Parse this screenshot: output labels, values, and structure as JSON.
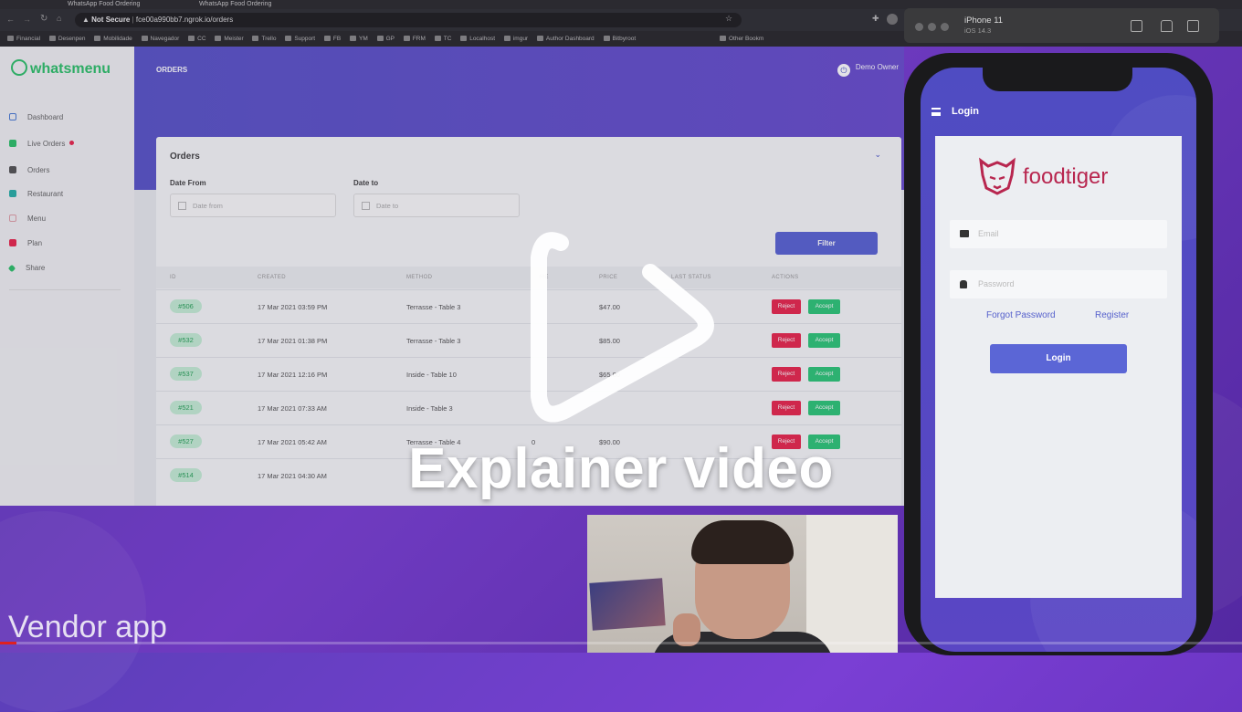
{
  "browser": {
    "tabs": [
      "WhatsApp Food Ordering",
      "WhatsApp Food Ordering"
    ],
    "security": "Not Secure",
    "url": "fce00a990bb7.ngrok.io/orders",
    "bookmarks": [
      "Financial",
      "Desenpen",
      "Mobilidade",
      "Navegador",
      "CC",
      "Meister",
      "Trello",
      "Support",
      "FB",
      "YM",
      "GP",
      "FRM",
      "TC",
      "Localhost",
      "imgur",
      "Author Dashboard",
      "Bitbyroot",
      "Other Bookm"
    ]
  },
  "app": {
    "logo": "whatsmenu",
    "header_title": "ORDERS",
    "user_name": "Demo Owner",
    "sidebar": {
      "items": [
        {
          "label": "Dashboard",
          "color": "#4a7bd4"
        },
        {
          "label": "Live Orders",
          "color": "#30c26b"
        },
        {
          "label": "Orders",
          "color": "#555555"
        },
        {
          "label": "Restaurant",
          "color": "#2ab0a8"
        },
        {
          "label": "Menu",
          "color": "#e0a0a8"
        },
        {
          "label": "Plan",
          "color": "#e8294f"
        },
        {
          "label": "Share",
          "color": "#30c26b"
        }
      ]
    },
    "orders": {
      "title": "Orders",
      "date_from_label": "Date From",
      "date_from_placeholder": "Date from",
      "date_to_label": "Date to",
      "date_to_placeholder": "Date to",
      "filter_label": "Filter",
      "columns": [
        "ID",
        "CREATED",
        "METHOD",
        "ME",
        "PRICE",
        "LAST STATUS",
        "ACTIONS"
      ],
      "reject_label": "Reject",
      "accept_label": "Accept",
      "rows": [
        {
          "id": "#506",
          "created": "17 Mar 2021 03:59 PM",
          "method": "Terrasse - Table 3",
          "qty": "",
          "price": "$47.00"
        },
        {
          "id": "#532",
          "created": "17 Mar 2021 01:38 PM",
          "method": "Terrasse - Table 3",
          "qty": "",
          "price": "$85.00"
        },
        {
          "id": "#537",
          "created": "17 Mar 2021 12:16 PM",
          "method": "Inside - Table 10",
          "qty": "",
          "price": "$65.00"
        },
        {
          "id": "#521",
          "created": "17 Mar 2021 07:33 AM",
          "method": "Inside - Table 3",
          "qty": "",
          "price": ""
        },
        {
          "id": "#527",
          "created": "17 Mar 2021 05:42 AM",
          "method": "Terrasse - Table 4",
          "qty": "0",
          "price": "$90.00"
        },
        {
          "id": "#514",
          "created": "17 Mar 2021 04:30 AM",
          "method": "",
          "qty": "",
          "price": ""
        }
      ]
    }
  },
  "simulator": {
    "device": "iPhone 11",
    "os": "iOS 14.3",
    "screen_title": "Login",
    "brand": "foodtiger",
    "email_placeholder": "Email",
    "password_placeholder": "Password",
    "forgot_label": "Forgot Password",
    "register_label": "Register",
    "login_label": "Login"
  },
  "overlay": {
    "title": "Explainer video",
    "caption": "Vendor app",
    "progress": 0.013
  },
  "colors": {
    "accent": "#5a64d4",
    "brand_green": "#30c26b",
    "reject": "#e8294f",
    "accept": "#2fc779",
    "foodtiger": "#b8264f"
  }
}
